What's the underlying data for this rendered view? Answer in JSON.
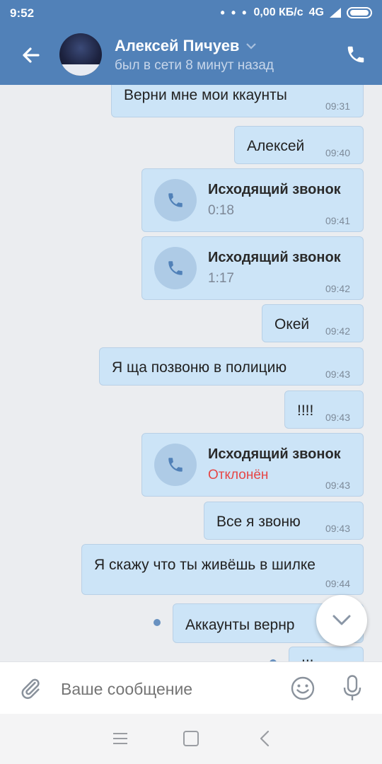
{
  "status_bar": {
    "time": "9:52",
    "network_speed": "0,00 КБ/с",
    "network_type": "4G"
  },
  "header": {
    "contact_name": "Алексей Пичуев",
    "last_seen": "был в сети 8 минут назад"
  },
  "messages": [
    {
      "type": "text",
      "text": "Верни мне мои ккаунты",
      "time": "09:31"
    },
    {
      "type": "text",
      "text": "Алексей",
      "time": "09:40"
    },
    {
      "type": "call",
      "title": "Исходящий звонок",
      "detail": "0:18",
      "time": "09:41"
    },
    {
      "type": "call",
      "title": "Исходящий звонок",
      "detail": "1:17",
      "time": "09:42"
    },
    {
      "type": "text",
      "text": "Окей",
      "time": "09:42"
    },
    {
      "type": "text",
      "text": "Я ща позвоню в полицию",
      "time": "09:43"
    },
    {
      "type": "text",
      "text": "!!!!",
      "time": "09:43"
    },
    {
      "type": "call",
      "title": "Исходящий звонок",
      "detail": "Отклонён",
      "time": "09:43"
    },
    {
      "type": "text",
      "text": "Все я звоню",
      "time": "09:43"
    },
    {
      "type": "text",
      "text": "Я скажу что ты живёшь в шилке",
      "time": "09:44"
    },
    {
      "type": "text",
      "text": "Аккаунты вернр",
      "time": ""
    },
    {
      "type": "text",
      "text": "!!!",
      "time": ""
    }
  ],
  "composer": {
    "placeholder": "Ваше сообщение"
  },
  "colors": {
    "header_bg": "#5181b8",
    "bubble_bg": "#cce4f7",
    "declined": "#e64646",
    "chat_bg": "#ebedf0"
  },
  "icons": [
    "back-arrow-icon",
    "chevron-down-icon",
    "phone-icon",
    "attach-icon",
    "emoji-icon",
    "microphone-icon",
    "menu-icon",
    "home-icon",
    "nav-back-icon"
  ]
}
